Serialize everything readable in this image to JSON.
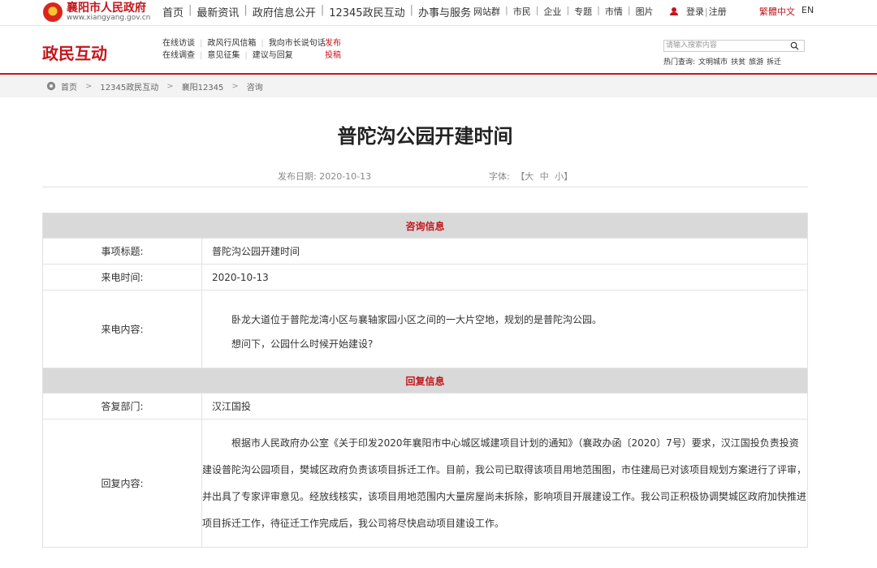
{
  "site": {
    "name": "襄阳市人民政府",
    "url": "www.xiangyang.gov.cn"
  },
  "main_nav": [
    "首页",
    "最新资讯",
    "政府信息公开",
    "12345政民互动",
    "办事与服务"
  ],
  "sub_nav": [
    "网站群",
    "市民",
    "企业",
    "专题",
    "市情",
    "图片"
  ],
  "account": {
    "login": "登录",
    "register": "注册"
  },
  "lang": {
    "traditional": "繁體中文",
    "english": "EN"
  },
  "section": {
    "title": "政民互动",
    "nav_row1": [
      "在线访谈",
      "政风行风信箱",
      "我向市长说句话"
    ],
    "nav_row2": [
      "在线调查",
      "意见征集",
      "建议与回复"
    ],
    "submit": "发布投稿"
  },
  "search": {
    "placeholder": "请输入搜索内容",
    "hot_label": "热门查询:",
    "hot_items": [
      "文明城市",
      "扶贫",
      "旅游",
      "拆迁"
    ]
  },
  "breadcrumb": [
    "首页",
    "12345政民互动",
    "襄阳12345",
    "咨询"
  ],
  "article": {
    "title": "普陀沟公园开建时间",
    "date_label": "发布日期:",
    "date": "2020-10-13",
    "font_label": "字体:",
    "font_sizes": [
      "【大",
      "中",
      "小】"
    ]
  },
  "consult": {
    "header": "咨询信息",
    "subject_label": "事项标题:",
    "subject": "普陀沟公园开建时间",
    "time_label": "来电时间:",
    "time": "2020-10-13",
    "content_label": "来电内容:",
    "content_p1": "卧龙大道位于普陀龙湾小区与襄轴家园小区之间的一大片空地，规划的是普陀沟公园。",
    "content_p2": "想问下，公园什么时候开始建设?"
  },
  "reply": {
    "header": "回复信息",
    "dept_label": "答复部门:",
    "dept": "汉江国投",
    "content_label": "回复内容:",
    "content": "根据市人民政府办公室《关于印发2020年襄阳市中心城区城建项目计划的通知》（襄政办函〔2020〕7号）要求，汉江国投负责投资建设普陀沟公园项目，樊城区政府负责该项目拆迁工作。目前，我公司已取得该项目用地范围图，市住建局已对该项目规划方案进行了评审，并出具了专家评审意见。经放线核实，该项目用地范围内大量房屋尚未拆除，影响项目开展建设工作。我公司正积极协调樊城区政府加快推进项目拆迁工作，待征迁工作完成后，我公司将尽快启动项目建设工作。"
  },
  "colors": {
    "brand_red": "#c4161c",
    "header_gray": "#d9d9d9"
  }
}
